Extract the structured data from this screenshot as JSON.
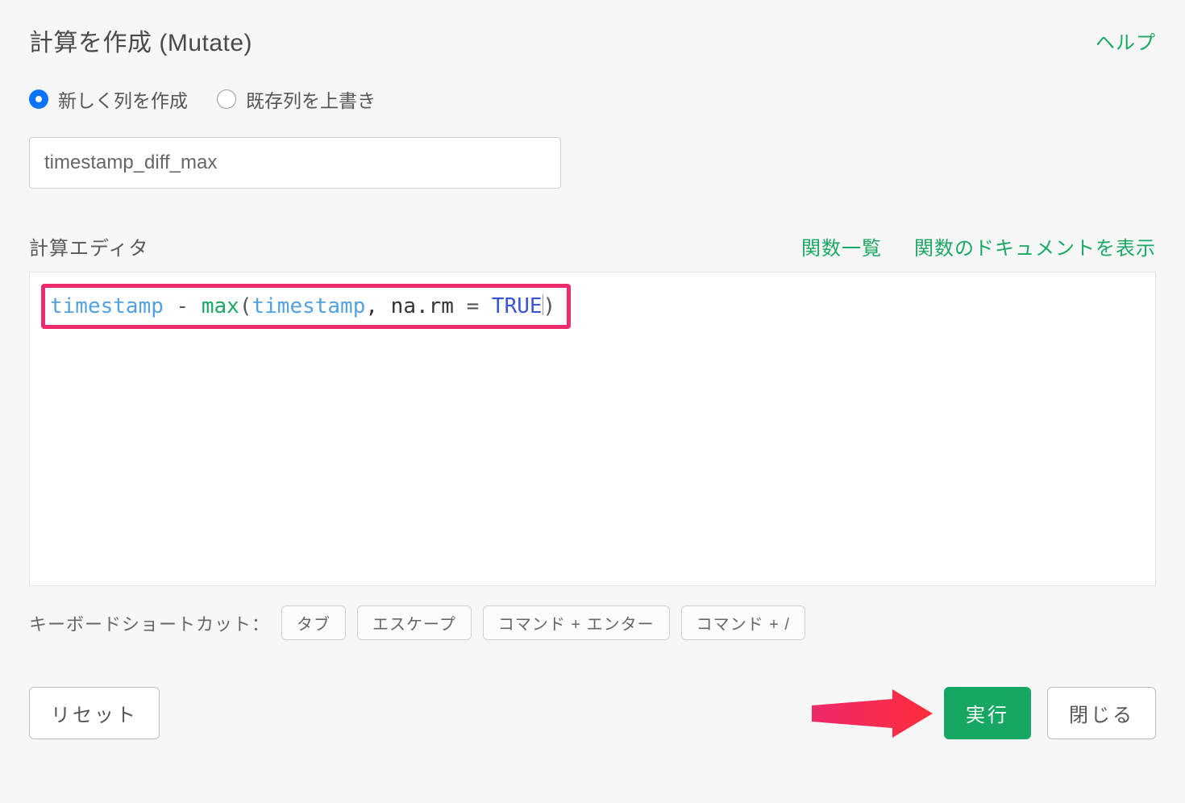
{
  "header": {
    "title": "計算を作成 (Mutate)",
    "help": "ヘルプ"
  },
  "radios": {
    "create_new": "新しく列を作成",
    "overwrite": "既存列を上書き",
    "selected": "create_new"
  },
  "column_name": "timestamp_diff_max",
  "editor": {
    "label": "計算エディタ",
    "link_functions": "関数一覧",
    "link_docs": "関数のドキュメントを表示",
    "expression_tokens": {
      "col1": "timestamp",
      "minus": " - ",
      "fn": "max",
      "open": "(",
      "col2": "timestamp",
      "comma_arg": ", na.rm ",
      "eq": "= ",
      "const": "TRUE",
      "close": ")"
    }
  },
  "shortcuts": {
    "label": "キーボードショートカット：",
    "keys": [
      "タブ",
      "エスケープ",
      "コマンド + エンター",
      "コマンド + /"
    ]
  },
  "footer": {
    "reset": "リセット",
    "run": "実行",
    "close": "閉じる"
  }
}
